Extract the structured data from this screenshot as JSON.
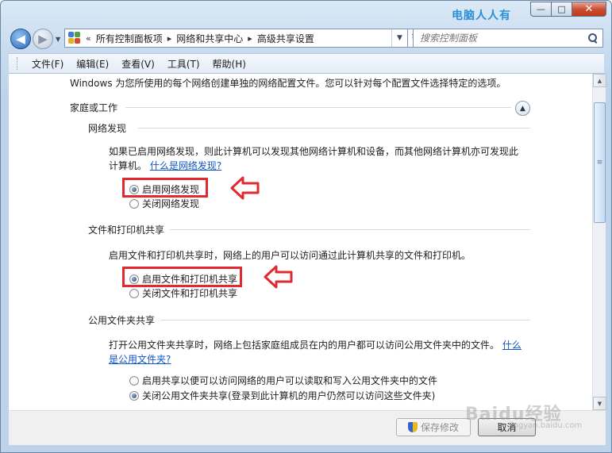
{
  "window": {
    "watermark_title": "电脑人人有",
    "caption": {
      "minimize": "—",
      "maximize": "□",
      "close": "✕"
    }
  },
  "nav": {
    "back_icon": "◀",
    "forward_icon": "▶",
    "dropdown_icon": "▼",
    "breadcrumb_chevron": "«",
    "breadcrumb": [
      "所有控制面板项",
      "网络和共享中心",
      "高级共享设置"
    ],
    "breadcrumb_sep": "▸",
    "address_dropdown_icon": "▼",
    "refresh_icon": "↻",
    "search_placeholder": "搜索控制面板"
  },
  "menu": {
    "items": [
      "文件(F)",
      "编辑(E)",
      "查看(V)",
      "工具(T)",
      "帮助(H)"
    ]
  },
  "content": {
    "intro": "Windows 为您所使用的每个网络创建单独的网络配置文件。您可以针对每个配置文件选择特定的选项。",
    "profile_title": "家庭或工作",
    "collapse_icon": "▲",
    "network_discovery": {
      "title": "网络发现",
      "desc": "如果已启用网络发现，则此计算机可以发现其他网络计算机和设备，而其他网络计算机亦可发现此计算机。",
      "link": "什么是网络发现?",
      "on_label": "启用网络发现",
      "off_label": "关闭网络发现",
      "selected": "on"
    },
    "file_printer_sharing": {
      "title": "文件和打印机共享",
      "desc": "启用文件和打印机共享时，网络上的用户可以访问通过此计算机共享的文件和打印机。",
      "on_label": "启用文件和打印机共享",
      "off_label": "关闭文件和打印机共享",
      "selected": "on"
    },
    "public_folder_sharing": {
      "title": "公用文件夹共享",
      "desc": "打开公用文件夹共享时，网络上包括家庭组成员在内的用户都可以访问公用文件夹中的文件。",
      "link": "什么是公用文件夹?",
      "on_label": "启用共享以便可以访问网络的用户可以读取和写入公用文件夹中的文件",
      "off_label": "关闭公用文件夹共享(登录到此计算机的用户仍然可以访问这些文件夹)",
      "selected": "off"
    }
  },
  "scrollbar": {
    "up_icon": "▲",
    "down_icon": "▼",
    "grip_icon": "≡"
  },
  "footer": {
    "save_label": "保存修改",
    "cancel_label": "取消"
  },
  "watermark": {
    "brand": "Baidu经验",
    "url": "jingyan.baidu.com"
  },
  "colors": {
    "annotation_red": "#e02a2f",
    "link": "#0d55c9"
  }
}
